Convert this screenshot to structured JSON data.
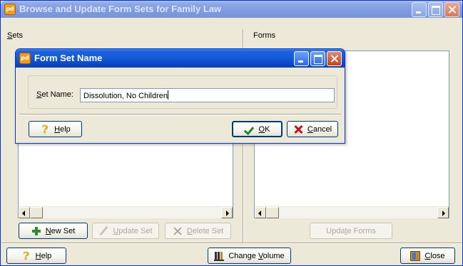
{
  "main_window": {
    "title": "Browse and Update Form Sets for Family Law",
    "app_icon": "pd",
    "sets_label_u": "S",
    "sets_label_rest": "ets",
    "forms_label": "Forms",
    "buttons": {
      "new_set_u": "N",
      "new_set_rest": "ew Set",
      "update_set_u": "U",
      "update_set_rest": "pdate Set",
      "delete_set_u": "D",
      "delete_set_rest": "elete Set",
      "update_forms_pre": "Upda",
      "update_forms_u": "t",
      "update_forms_rest": "e Forms",
      "help_u": "H",
      "help_rest": "elp",
      "change_volume_pre": "Change ",
      "change_volume_u": "V",
      "change_volume_rest": "olume",
      "close_u": "C",
      "close_rest": "lose"
    }
  },
  "dialog": {
    "title": "Form Set Name",
    "app_icon": "pd",
    "field_label_u": "S",
    "field_label_rest": "et Name:",
    "field_value": "Dissolution, No Children",
    "help_u": "H",
    "help_rest": "elp",
    "ok_u": "O",
    "ok_rest": "K",
    "cancel_u": "C",
    "cancel_rest": "ancel"
  },
  "icons": [
    "pd-app-icon",
    "minimize-icon",
    "maximize-icon",
    "close-icon",
    "plus-icon",
    "pencil-icon",
    "x-icon",
    "help-icon",
    "checkmark-icon",
    "volume-icon",
    "door-icon"
  ],
  "colors": {
    "titlebar": "#0b48c9",
    "window_bg": "#ece9d8",
    "border": "#0831d9"
  }
}
